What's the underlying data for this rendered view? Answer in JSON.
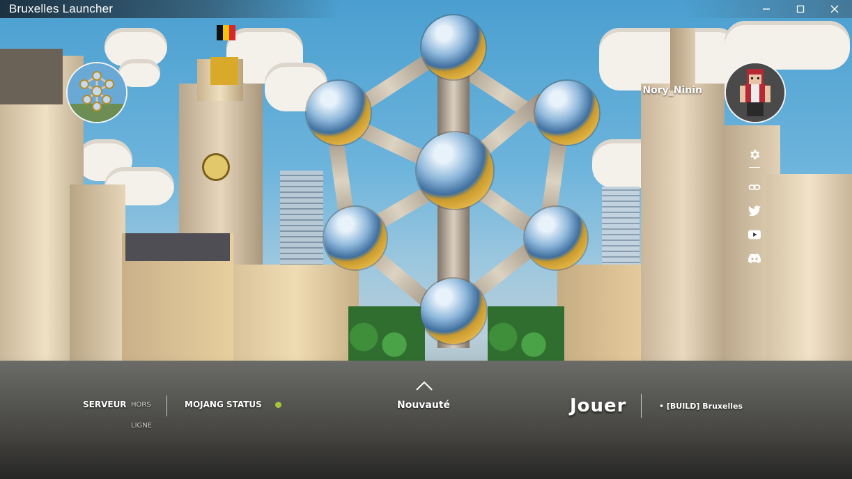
{
  "window": {
    "title": "Bruxelles Launcher",
    "controls": [
      "minimize",
      "maximize",
      "close"
    ]
  },
  "user": {
    "name": "Nory_Ninin"
  },
  "side_icons": [
    "gear-icon",
    "link-icon",
    "twitter-icon",
    "youtube-icon",
    "discord-icon"
  ],
  "status": {
    "server_label": "SERVEUR",
    "server_state_line1": "HORS",
    "server_state_line2": "LIGNE",
    "mojang_label": "MOJANG STATUS",
    "mojang_color": "#a4c639"
  },
  "actions": {
    "news_label": "Nouvauté",
    "play_label": "Jouer",
    "version": "• [BUILD] Bruxelles"
  },
  "colors": {
    "accent": "#ffffff",
    "status_ok": "#a4c639"
  }
}
